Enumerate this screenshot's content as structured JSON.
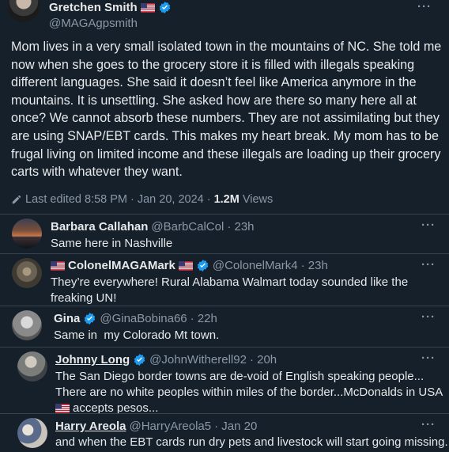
{
  "tweet": {
    "author_name": "Gretchen Smith",
    "author_handle": "@MAGAgpsmith",
    "body": "Mom lives in a very small isolated town in the mountains of NC. She told me now when she goes to the grocery store it is filled with illegals speaking different languages. She said it doesn’t feel like America anymore in the mountains. It is unsettling. She asked how are there so many here all at once? We cannot absorb these numbers. They are not assimilating but they are using SNAP/EBT cards. This makes my heart break. My mom has to be frugal living on limited income and these illegals are loading up their grocery carts with whatever they want.",
    "edit_label": "Last edited 8:58 PM · Jan 20, 2024 ·",
    "views_count": "1.2M",
    "views_label": "Views"
  },
  "more_label": "···",
  "replies": [
    {
      "name": "Barbara Callahan",
      "handle": "@BarbCalCol",
      "time": "· 23h",
      "text": "Same here in Nashville"
    },
    {
      "name": "ColonelMAGAMark",
      "handle": "@ColonelMark4",
      "time": "· 23h",
      "text": "They’re everywhere! Rural Alabama Walmart today sounded like the freaking UN!"
    },
    {
      "name": "Gina",
      "handle": "@GinaBobina66",
      "time": "· 22h",
      "text": "Same in  my Colorado Mt town."
    },
    {
      "name": "Johnny Long",
      "handle": "@JohnWitherell92",
      "time": "· 20h",
      "text_line1": "The San Diego border towns are de-void of English speaking people...",
      "text_line2": "There are no white peoples within miles of the border...McDonalds in USA",
      "text_line3": "accepts pesos..."
    },
    {
      "name": "Harry Areola",
      "handle": "@HarryAreola5",
      "time": "· Jan 20",
      "text": "and when the EBT cards run dry pets and livestock will start going missing."
    }
  ],
  "colors": {
    "background": "#15202b",
    "text": "#e7e9ea",
    "secondary": "#8b98a5",
    "verified": "#1d9bf0",
    "divider": "#38444d"
  }
}
